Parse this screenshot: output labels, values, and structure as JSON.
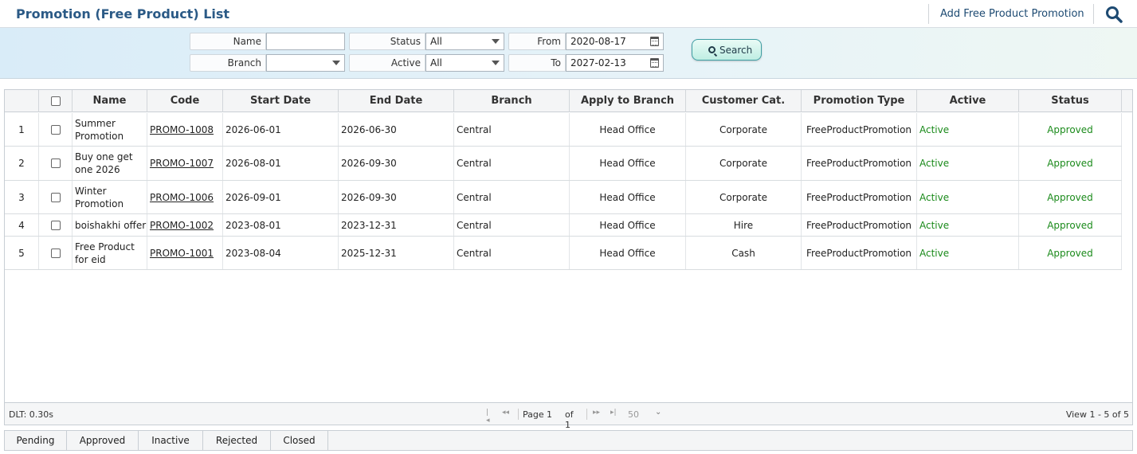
{
  "header": {
    "title": "Promotion (Free Product) List",
    "add_link": "Add Free Product Promotion"
  },
  "filters": {
    "name_label": "Name",
    "name_value": "",
    "branch_label": "Branch",
    "branch_value": "",
    "status_label": "Status",
    "status_value": "All",
    "active_label": "Active",
    "active_value": "All",
    "from_label": "From",
    "from_value": "2020-08-17",
    "to_label": "To",
    "to_value": "2027-02-13",
    "search_label": "Search"
  },
  "table": {
    "columns": [
      "Name",
      "Code",
      "Start Date",
      "End Date",
      "Branch",
      "Apply to Branch",
      "Customer Cat.",
      "Promotion Type",
      "Active",
      "Status"
    ],
    "rows": [
      {
        "num": "1",
        "name": "Summer Promotion",
        "code": "PROMO-1008",
        "start": "2026-06-01",
        "end": "2026-06-30",
        "branch": "Central",
        "apply": "Head Office",
        "cat": "Corporate",
        "type": "FreeProductPromotion",
        "active": "Active",
        "status": "Approved"
      },
      {
        "num": "2",
        "name": "Buy one get one 2026",
        "code": "PROMO-1007",
        "start": "2026-08-01",
        "end": "2026-09-30",
        "branch": "Central",
        "apply": "Head Office",
        "cat": "Corporate",
        "type": "FreeProductPromotion",
        "active": "Active",
        "status": "Approved"
      },
      {
        "num": "3",
        "name": "Winter Promotion",
        "code": "PROMO-1006",
        "start": "2026-09-01",
        "end": "2026-09-30",
        "branch": "Central",
        "apply": "Head Office",
        "cat": "Corporate",
        "type": "FreeProductPromotion",
        "active": "Active",
        "status": "Approved"
      },
      {
        "num": "4",
        "name": "boishakhi offer",
        "code": "PROMO-1002",
        "start": "2023-08-01",
        "end": "2023-12-31",
        "branch": "Central",
        "apply": "Head Office",
        "cat": "Hire",
        "type": "FreeProductPromotion",
        "active": "Active",
        "status": "Approved"
      },
      {
        "num": "5",
        "name": "Free Product for eid",
        "code": "PROMO-1001",
        "start": "2023-08-04",
        "end": "2025-12-31",
        "branch": "Central",
        "apply": "Head Office",
        "cat": "Cash",
        "type": "FreeProductPromotion",
        "active": "Active",
        "status": "Approved"
      }
    ]
  },
  "footer": {
    "dlt": "DLT: 0.30s",
    "page_label": "Page",
    "page_value": "1",
    "of_label": "of 1",
    "page_size": "50",
    "view_info": "View 1 - 5 of 5"
  },
  "tabs": [
    "Pending",
    "Approved",
    "Inactive",
    "Rejected",
    "Closed"
  ],
  "colors": {
    "title": "#2b5a86",
    "active_green": "#1a8a1a"
  }
}
